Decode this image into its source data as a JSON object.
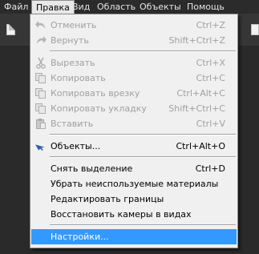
{
  "menubar": {
    "items": [
      {
        "label": "Файл"
      },
      {
        "label": "Правка"
      },
      {
        "label": "Вид"
      },
      {
        "label": "Область"
      },
      {
        "label": "Объекты"
      },
      {
        "label": "Помощь"
      }
    ],
    "active": "Правка"
  },
  "edit_menu": {
    "items": [
      {
        "label": "Отменить",
        "shortcut": "Ctrl+Z",
        "icon": "undo-icon",
        "enabled": false
      },
      {
        "label": "Вернуть",
        "shortcut": "Shift+Ctrl+Z",
        "icon": "redo-icon",
        "enabled": false
      },
      {
        "label": "Вырезать",
        "shortcut": "Ctrl+X",
        "icon": "scissors-icon",
        "enabled": false
      },
      {
        "label": "Копировать",
        "shortcut": "Ctrl+C",
        "icon": "copy-icon",
        "enabled": false
      },
      {
        "label": "Копировать врезку",
        "shortcut": "Ctrl+Alt+C",
        "icon": "copy-inset-icon",
        "enabled": false
      },
      {
        "label": "Копировать укладку",
        "shortcut": "Shift+Ctrl+C",
        "icon": "copy-layout-icon",
        "enabled": false
      },
      {
        "label": "Вставить",
        "shortcut": "Ctrl+V",
        "icon": "paste-icon",
        "enabled": false
      },
      {
        "label": "Объекты...",
        "shortcut": "Ctrl+Alt+O",
        "icon": "pointer-arrow-icon",
        "enabled": true
      },
      {
        "label": "Снять выделение",
        "shortcut": "Ctrl+D",
        "enabled": true
      },
      {
        "label": "Убрать неиспользуемые материалы",
        "shortcut": "",
        "enabled": true
      },
      {
        "label": "Редактировать границы",
        "shortcut": "",
        "enabled": true
      },
      {
        "label": "Восстановить камеры в видах",
        "shortcut": "",
        "enabled": true
      },
      {
        "label": "Настройки...",
        "shortcut": "",
        "enabled": true,
        "selected": true
      }
    ]
  },
  "colors": {
    "selection": "#3399ff",
    "menu_background": "#f0f0f0",
    "disabled_text": "#a0a0a0",
    "menubar_background": "#2b2b2b"
  }
}
